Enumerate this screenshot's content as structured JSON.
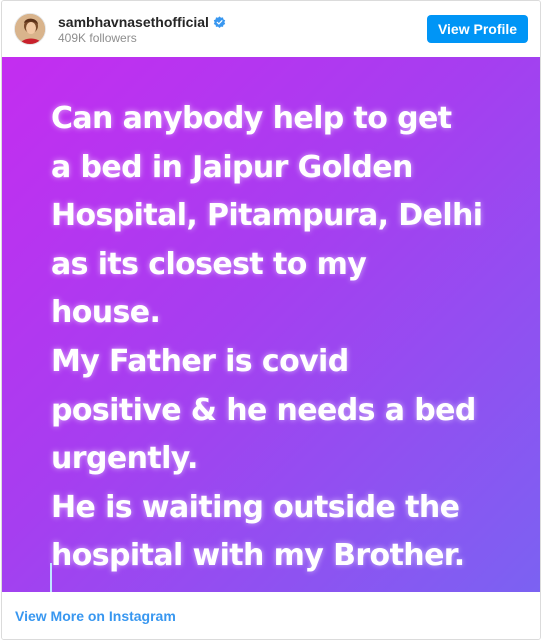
{
  "header": {
    "username": "sambhavnasethofficial",
    "followers": "409K followers",
    "view_profile_label": "View Profile",
    "verified_icon": "verified-badge-icon",
    "avatar_icon": "profile-avatar"
  },
  "post": {
    "lines": [
      "Can anybody help to get",
      "a bed in Jaipur Golden",
      "Hospital, Pitampura, Delhi",
      "as its closest to my",
      "house.",
      "My Father is covid",
      "positive & he needs a bed",
      "urgently.",
      "He is waiting outside the",
      "hospital with my Brother."
    ]
  },
  "footer": {
    "view_more_label": "View More on Instagram"
  },
  "colors": {
    "accent": "#0095f6",
    "link": "#3897f0",
    "gradient_start": "#c42df0",
    "gradient_end": "#7b62f2"
  }
}
